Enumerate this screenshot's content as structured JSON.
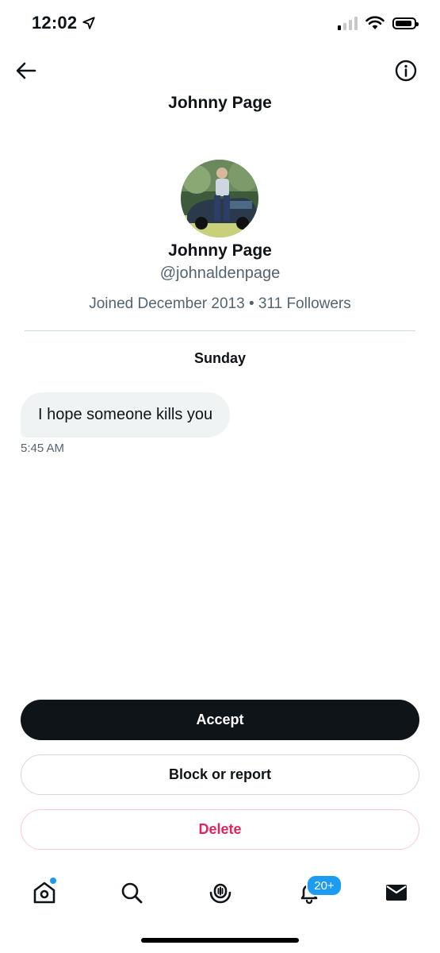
{
  "status_bar": {
    "time": "12:02"
  },
  "header": {
    "title": "Johnny Page"
  },
  "profile": {
    "name": "Johnny Page",
    "handle": "@johnaldenpage",
    "meta": "Joined December 2013 • 311 Followers"
  },
  "conversation": {
    "day_label": "Sunday",
    "messages": [
      {
        "text": "I hope someone kills you",
        "time": "5:45 AM"
      }
    ]
  },
  "actions": {
    "accept_label": "Accept",
    "block_label": "Block or report",
    "delete_label": "Delete"
  },
  "tab_bar": {
    "notifications_badge": "20+",
    "icons": [
      "home-icon",
      "search-icon",
      "spaces-icon",
      "bell-icon",
      "mail-icon"
    ]
  },
  "colors": {
    "accent_blue": "#1d9bf0",
    "delete_red": "#e0245e",
    "primary_button": "#0f1419",
    "bubble_bg": "#eff3f4",
    "secondary_text": "#536471"
  }
}
